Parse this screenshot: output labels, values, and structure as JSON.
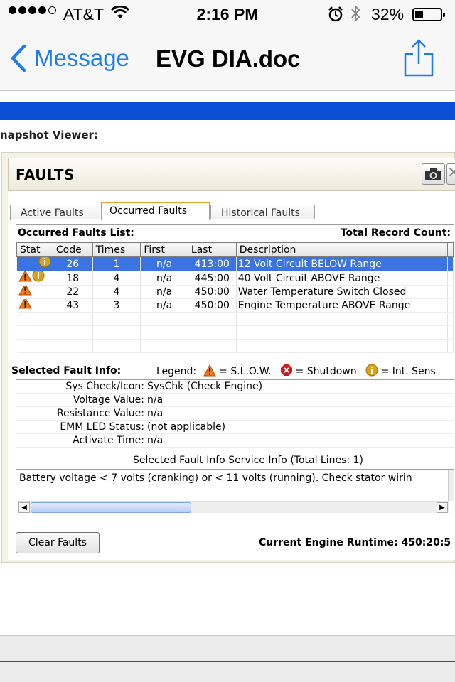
{
  "status_bar": {
    "carrier": "AT&T",
    "time": "2:16 PM",
    "battery": "32%",
    "battery_level": 0.32
  },
  "nav": {
    "back_label": "Message",
    "title": "EVG DIA.doc"
  },
  "document": {
    "snapshot_label": "napshot Viewer:",
    "faults_title": "FAULTS",
    "tabs": [
      {
        "label": "Active Faults",
        "active": false
      },
      {
        "label": "Occurred Faults",
        "active": true
      },
      {
        "label": "Historical Faults",
        "active": false
      }
    ],
    "list_label": "Occurred Faults List:",
    "record_count_label": "Total Record Count:",
    "columns": [
      "Stat",
      "Code",
      "Times",
      "First",
      "Last",
      "Description"
    ],
    "rows": [
      {
        "icons": [
          "info-icon"
        ],
        "code": "26",
        "times": "1",
        "first": "n/a",
        "last": "413:00",
        "description": "12 Volt Circuit BELOW Range",
        "selected": true
      },
      {
        "icons": [
          "warning-icon",
          "info-icon"
        ],
        "code": "18",
        "times": "4",
        "first": "n/a",
        "last": "445:00",
        "description": "40 Volt Circuit ABOVE Range",
        "selected": false
      },
      {
        "icons": [
          "warning-icon"
        ],
        "code": "22",
        "times": "4",
        "first": "n/a",
        "last": "450:00",
        "description": "Water Temperature Switch Closed",
        "selected": false
      },
      {
        "icons": [
          "warning-icon"
        ],
        "code": "43",
        "times": "3",
        "first": "n/a",
        "last": "450:00",
        "description": "Engine Temperature ABOVE Range",
        "selected": false
      }
    ],
    "selected_info_label": "Selected Fault Info:",
    "legend": {
      "label": "Legend:",
      "slow": "= S.L.O.W.",
      "shutdown": "= Shutdown",
      "int_sens": "= Int. Sens"
    },
    "info_rows": [
      {
        "key": "Sys Check/Icon:",
        "value": "SysChk (Check Engine)"
      },
      {
        "key": "Voltage Value:",
        "value": "n/a"
      },
      {
        "key": "Resistance Value:",
        "value": "n/a"
      },
      {
        "key": "EMM LED Status:",
        "value": "(not applicable)"
      },
      {
        "key": "Activate Time:",
        "value": "n/a"
      }
    ],
    "service_info_label": "Selected Fault Info Service Info (Total Lines: 1)",
    "service_text": "Battery voltage < 7 volts (cranking) or < 11 volts (running).  Check stator wirin",
    "clear_button": "Clear Faults",
    "runtime": "Current Engine Runtime: 450:20:5"
  },
  "colors": {
    "ios_blue": "#1e7cf2",
    "doc_band": "#0a4fd6",
    "selection": "#3b73e0",
    "warning": "#f07a1a",
    "info": "#d9a21a",
    "shutdown": "#c81e1e"
  }
}
